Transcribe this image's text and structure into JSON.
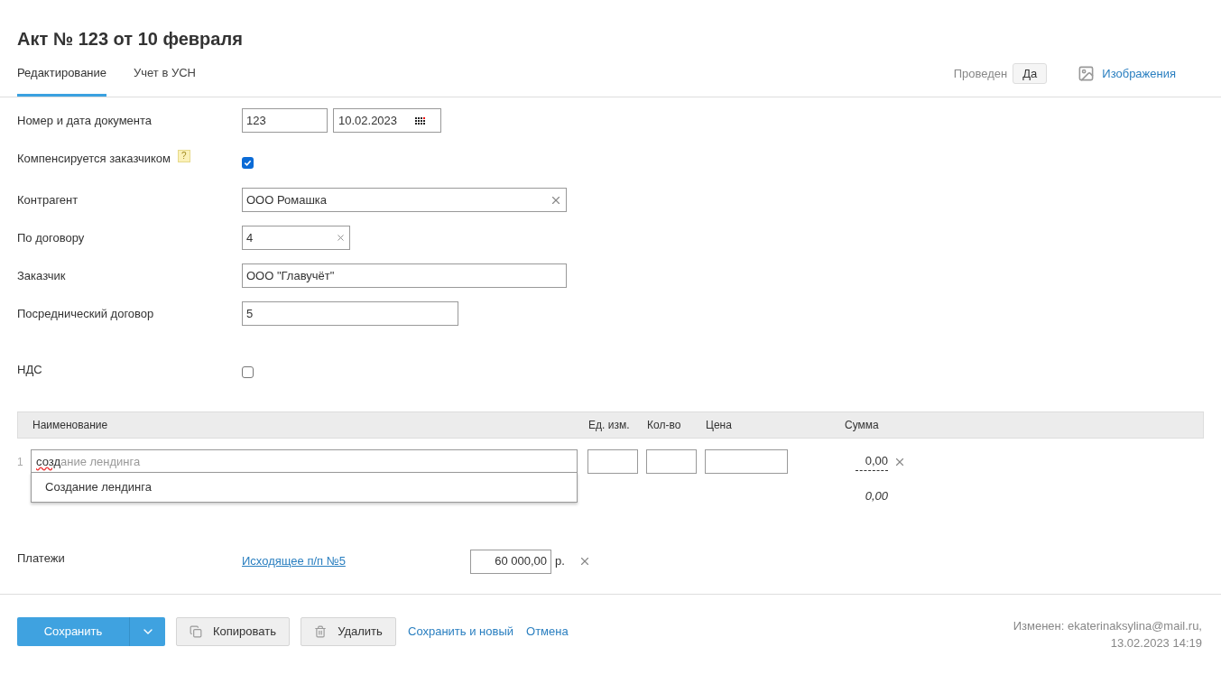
{
  "title": "Акт № 123 от 10 февраля",
  "tabs": [
    {
      "label": "Редактирование",
      "selected": true
    },
    {
      "label": "Учет в УСН",
      "selected": false
    }
  ],
  "posted": {
    "label": "Проведен",
    "value": "Да"
  },
  "images_link": "Изображения",
  "fields": [
    {
      "kind": "number_date",
      "label": "Номер и дата документа",
      "number": "123",
      "date": "10.02.2023"
    },
    {
      "kind": "checkbox",
      "label": "Компенсируется заказчиком",
      "help": "?",
      "checked": true
    },
    {
      "kind": "text",
      "label": "Контрагент",
      "value": "ООО Ромашка",
      "clearable": true
    },
    {
      "kind": "text",
      "label": "По договору",
      "value": "4",
      "clearable": true
    },
    {
      "kind": "text",
      "label": "Заказчик",
      "value": "ООО \"Главучёт\"",
      "clearable": false
    },
    {
      "kind": "text",
      "label": "Посреднический договор",
      "value": "5",
      "clearable": false
    },
    {
      "kind": "checkbox",
      "label": "НДС",
      "checked": false
    }
  ],
  "table": {
    "columns": [
      "Наименование",
      "Ед. изм.",
      "Кол-во",
      "Цена",
      "Сумма"
    ],
    "rows": [
      {
        "number": "1",
        "name_typed": "созд",
        "name_hint": "ание лендинга",
        "unit": "",
        "qty": "",
        "price": "",
        "sum": "0,00"
      }
    ],
    "suggestions": [
      "Создание лендинга"
    ],
    "total": "0,00"
  },
  "payments": {
    "label": "Платежи",
    "document": "Исходящее п/п №5",
    "amount": "60 000,00",
    "currency": "р."
  },
  "buttons": {
    "save": "Сохранить",
    "copy": "Копировать",
    "delete": "Удалить",
    "save_new": "Сохранить и новый",
    "cancel": "Отмена"
  },
  "modified": {
    "line1": "Изменен: ekaterinaksylina@mail.ru,",
    "line2": "13.02.2023 14:19"
  }
}
